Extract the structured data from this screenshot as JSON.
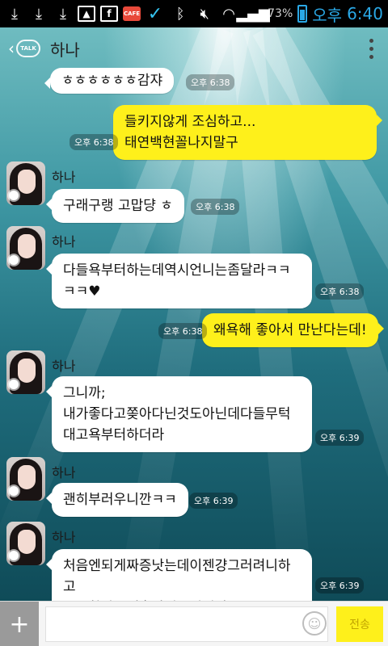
{
  "status_bar": {
    "battery_text": "73%",
    "ampm": "오후",
    "time": "6:40",
    "icons": [
      "download-icon",
      "download-icon",
      "download-icon",
      "image-icon",
      "facebook-icon",
      "cafe-icon",
      "check-icon",
      "bluetooth-icon",
      "mute-icon",
      "wifi-icon",
      "signal-icon",
      "battery-icon"
    ]
  },
  "header": {
    "title": "하나",
    "back_badge": "TALK"
  },
  "messages": [
    {
      "sender": "other",
      "text": "ㅎㅎㅎㅎㅎㅎ감쟈",
      "time": "오후 6:38"
    },
    {
      "sender": "me",
      "text": "들키지않게 조심하고...\n태연백현꼴나지말구",
      "time": "오후 6:38"
    },
    {
      "sender": "other",
      "name": "하나",
      "text": "구래구랭 고맙댱 ㅎ",
      "time": "오후 6:38"
    },
    {
      "sender": "other",
      "name": "하나",
      "text": "다들욕부터하는데역시언니는좀달라ㅋㅋ\nㅋㅋ♥",
      "time": "오후 6:38"
    },
    {
      "sender": "me",
      "text": "왜욕해 좋아서 만난다는데!",
      "time": "오후 6:38"
    },
    {
      "sender": "other",
      "name": "하나",
      "text": "그니까;\n내가좋다고쫒아다닌것도아닌데다들무턱\n대고욕부터하더라",
      "time": "오후 6:39"
    },
    {
      "sender": "other",
      "name": "하나",
      "text": "괜히부러우니깐ㅋㅋ",
      "time": "오후 6:39"
    },
    {
      "sender": "other",
      "name": "하나",
      "text": "처음엔되게짜증낫는데이젠걍그러려니하고\n무시함난오세훈만잇음되니까",
      "time": "오후 6:39"
    }
  ],
  "input_bar": {
    "plus_label": "+",
    "send_label": "전송",
    "placeholder": ""
  }
}
